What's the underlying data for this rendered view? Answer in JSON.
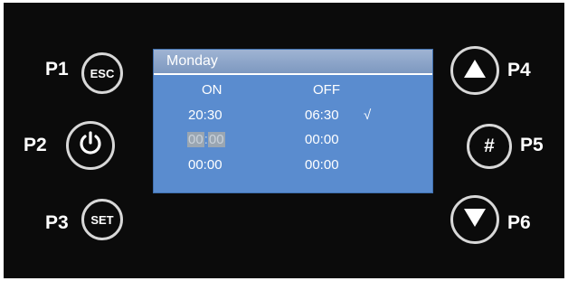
{
  "buttons": {
    "p1": {
      "label": "P1",
      "text": "ESC"
    },
    "p2": {
      "label": "P2"
    },
    "p3": {
      "label": "P3",
      "text": "SET"
    },
    "p4": {
      "label": "P4"
    },
    "p5": {
      "label": "P5",
      "text": "#"
    },
    "p6": {
      "label": "P6"
    }
  },
  "screen": {
    "title": "Monday",
    "columns": {
      "on": "ON",
      "off": "OFF"
    },
    "rows": [
      {
        "on": "20:30",
        "off": "06:30",
        "mark": "√"
      },
      {
        "on_hours": "00",
        "on_sep": ":",
        "on_minutes": "00",
        "off": "00:00"
      },
      {
        "on": "00:00",
        "off": "00:00"
      }
    ]
  },
  "colors": {
    "background": "#0b0b0b",
    "screen": "#5a8ccf",
    "text": "#ffffff"
  },
  "icons": {
    "p2": "power-icon",
    "p4": "triangle-up-icon",
    "p6": "triangle-down-icon"
  }
}
